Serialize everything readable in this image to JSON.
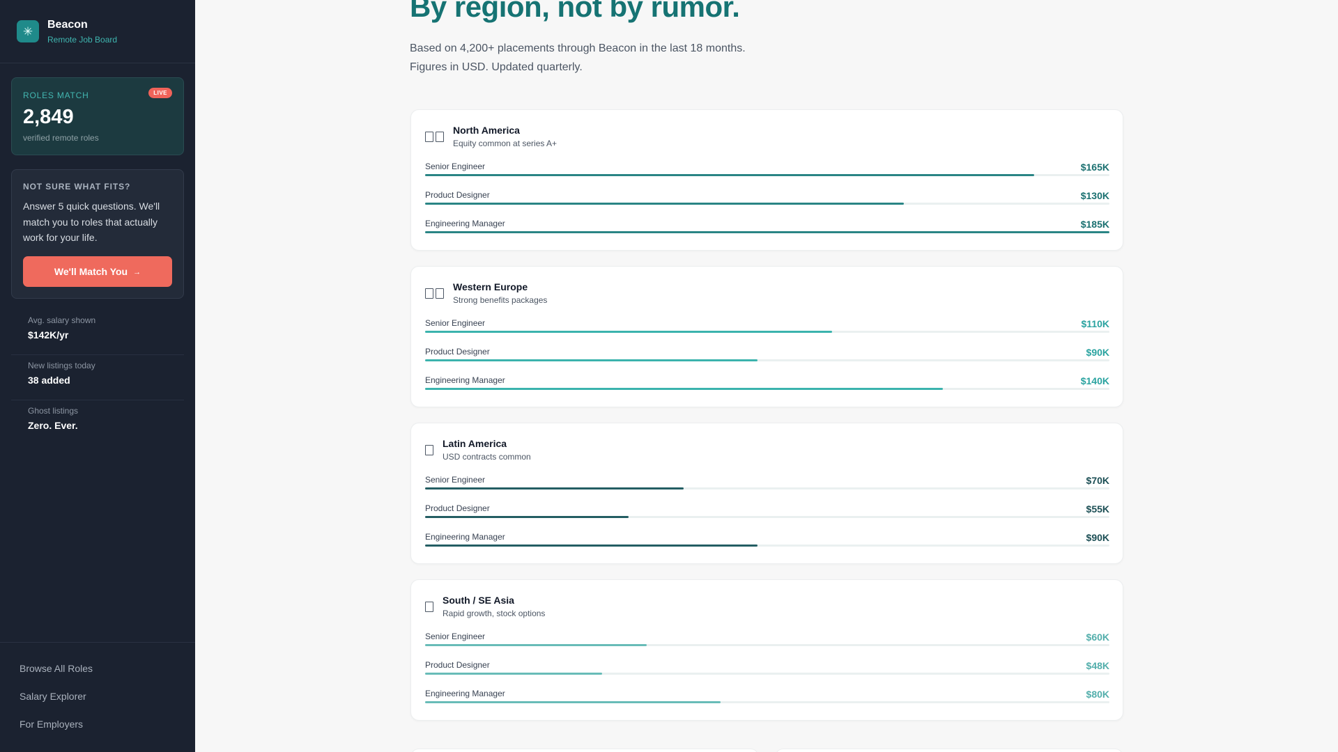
{
  "brand": {
    "name": "Beacon",
    "subtitle": "Remote Job Board",
    "logo_icon": "✳"
  },
  "roles_match": {
    "label": "Roles Match",
    "badge": "LIVE",
    "count": "2,849",
    "caption": "verified remote roles"
  },
  "fit_card": {
    "label": "Not Sure What Fits?",
    "text": "Answer 5 quick questions. We'll match you to roles that actually work for your life.",
    "button_label": "We'll Match You",
    "button_arrow": "→"
  },
  "stats": [
    {
      "label": "Avg. salary shown",
      "value": "$142K/yr"
    },
    {
      "label": "New listings today",
      "value": "38 added"
    },
    {
      "label": "Ghost listings",
      "value": "Zero. Ever."
    }
  ],
  "nav": [
    {
      "label": "Browse All Roles"
    },
    {
      "label": "Salary Explorer"
    },
    {
      "label": "For Employers"
    }
  ],
  "hero": {
    "headline": "By region, not by rumor.",
    "subcopy_line1": "Based on 4,200+ placements through Beacon in the last 18 months.",
    "subcopy_line2": "Figures in USD. Updated quarterly."
  },
  "regions": [
    {
      "name": "North America",
      "note": "Equity common at series A+",
      "flag_boxes": 2,
      "color": "#1a7070",
      "bar_color": "#2a8585",
      "roles": [
        {
          "name": "Senior Engineer",
          "salary": "$165K",
          "fill_pct": 89
        },
        {
          "name": "Product Designer",
          "salary": "$130K",
          "fill_pct": 70
        },
        {
          "name": "Engineering Manager",
          "salary": "$185K",
          "fill_pct": 100
        }
      ]
    },
    {
      "name": "Western Europe",
      "note": "Strong benefits packages",
      "flag_boxes": 2,
      "color": "#2aa3a0",
      "bar_color": "#3bb3ad",
      "roles": [
        {
          "name": "Senior Engineer",
          "salary": "$110K",
          "fill_pct": 59.5
        },
        {
          "name": "Product Designer",
          "salary": "$90K",
          "fill_pct": 48.6
        },
        {
          "name": "Engineering Manager",
          "salary": "$140K",
          "fill_pct": 75.7
        }
      ]
    },
    {
      "name": "Latin America",
      "note": "USD contracts common",
      "flag_boxes": 1,
      "color": "#1c4f55",
      "bar_color": "#245e63",
      "roles": [
        {
          "name": "Senior Engineer",
          "salary": "$70K",
          "fill_pct": 37.8
        },
        {
          "name": "Product Designer",
          "salary": "$55K",
          "fill_pct": 29.7
        },
        {
          "name": "Engineering Manager",
          "salary": "$90K",
          "fill_pct": 48.6
        }
      ]
    },
    {
      "name": "South / SE Asia",
      "note": "Rapid growth, stock options",
      "flag_boxes": 1,
      "color": "#52aeab",
      "bar_color": "#68bcb8",
      "roles": [
        {
          "name": "Senior Engineer",
          "salary": "$60K",
          "fill_pct": 32.4
        },
        {
          "name": "Product Designer",
          "salary": "$48K",
          "fill_pct": 25.9
        },
        {
          "name": "Engineering Manager",
          "salary": "$80K",
          "fill_pct": 43.2
        }
      ]
    }
  ]
}
